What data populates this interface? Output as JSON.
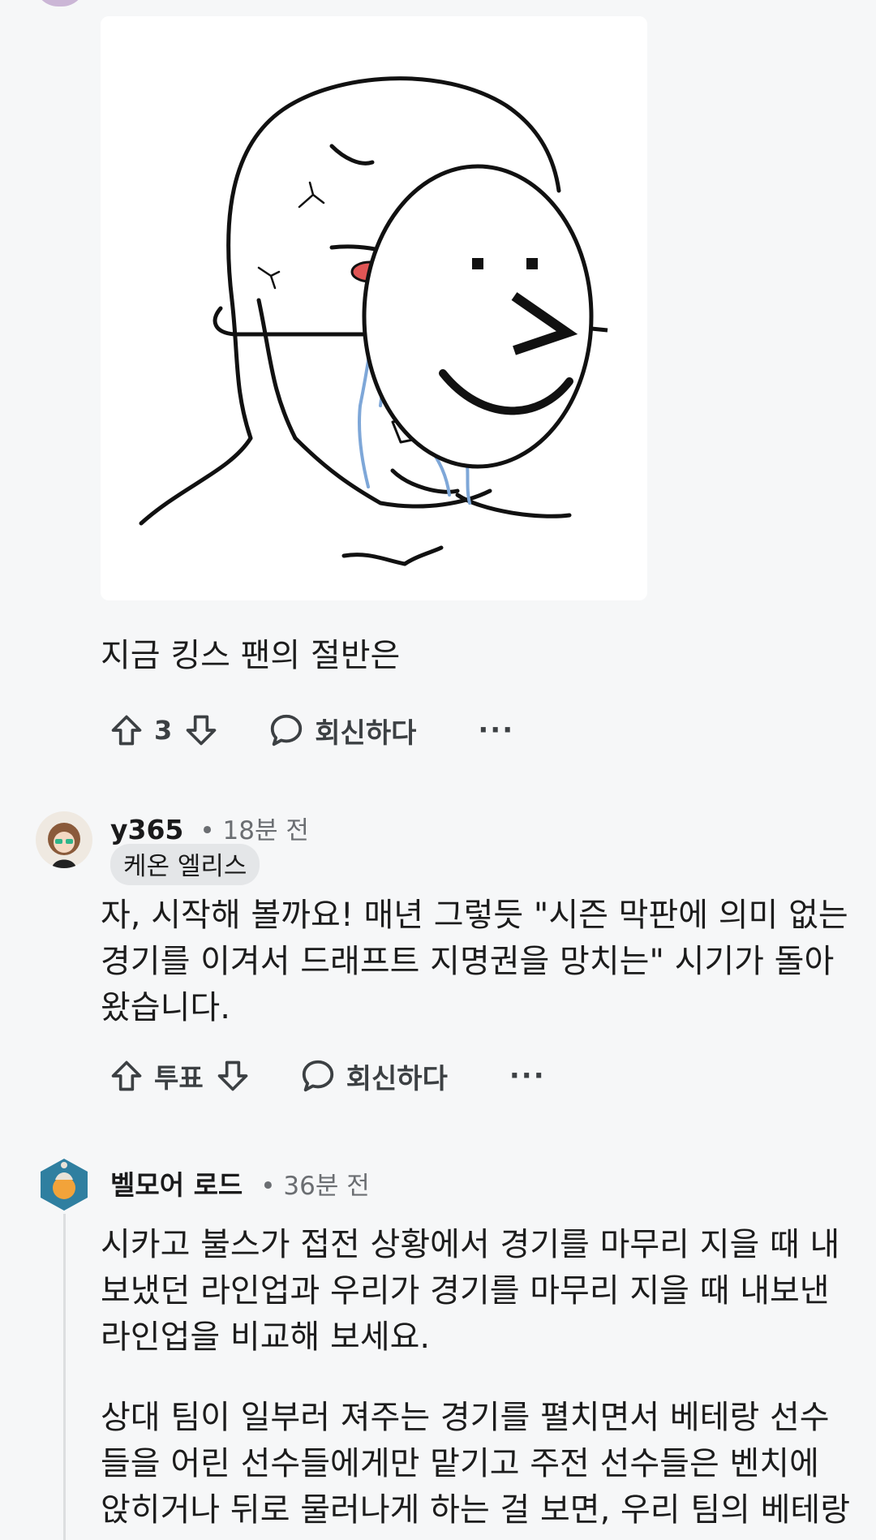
{
  "comment1": {
    "text": "지금 킹스 팬의 절반은",
    "upvote_count": "3",
    "reply_label": "회신하다",
    "more_label": "···"
  },
  "comment2": {
    "username": "y365",
    "time": "• 18분 전",
    "flair": "케온 엘리스",
    "text": "자, 시작해 볼까요! 매년 그렇듯 \"시즌 막판에 의미 없는\n경기를 이겨서 드래프트 지명권을 망치는\" 시기가 돌아\n왔습니다.",
    "vote_label": "투표",
    "reply_label": "회신하다",
    "more_label": "···"
  },
  "comment3": {
    "username": "벨모어 로드",
    "time": "• 36분 전",
    "paragraph1": "시카고 불스가 접전 상황에서 경기를 마무리 지을 때 내\n보냈던 라인업과 우리가 경기를 마무리 지을 때 내보낸\n라인업을 비교해 보세요.",
    "paragraph2": "상대 팀이 일부러 져주는 경기를 펼치면서 베테랑 선수\n들을 어린 선수들에게만 맡기고 주전 선수들은 벤치에\n앉히거나 뒤로 물러나게 하는 걸 보면, 우리 팀의 베테랑"
  },
  "icons": {
    "upvote": "arrow-up-icon",
    "downvote": "arrow-down-icon",
    "reply": "speech-bubble-icon",
    "more": "ellipsis-icon"
  },
  "colors": {
    "background": "#f6f7f8",
    "text": "#1c1c1c",
    "muted": "#6b6e72",
    "flair_bg": "#e4e6e8",
    "tear_blue": "#7ea7d8",
    "eye_red": "#e05555"
  }
}
